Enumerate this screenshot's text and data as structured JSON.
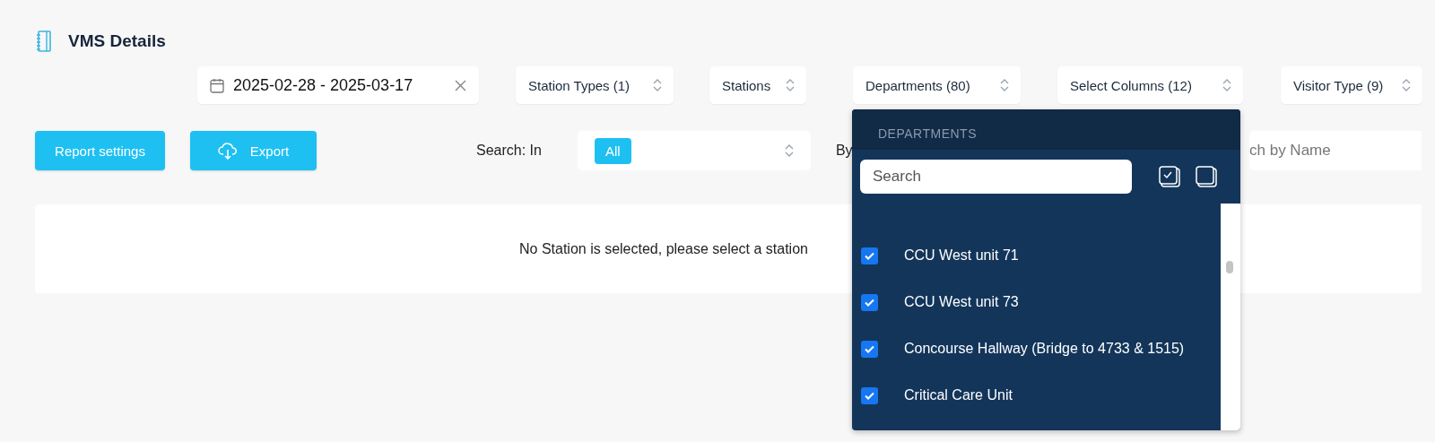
{
  "page": {
    "title": "VMS Details"
  },
  "filters": {
    "date_range": "2025-02-28 - 2025-03-17",
    "dropdowns": [
      {
        "label": "Station Types (1)"
      },
      {
        "label": "Stations"
      },
      {
        "label": "Departments (80)"
      },
      {
        "label": "Select Columns (12)"
      },
      {
        "label": "Visitor Type (9)"
      }
    ]
  },
  "actions": [
    {
      "label": "Report settings",
      "kind": "plain"
    },
    {
      "label": "Export",
      "kind": "export"
    }
  ],
  "search": {
    "in_label": "Search: In",
    "in_chip": "All",
    "by_label": "By",
    "name_placeholder": "ch by Name"
  },
  "message": "No Station is selected, please select a station",
  "departments_menu": {
    "heading": "DEPARTMENTS",
    "search_placeholder": "Search",
    "items": [
      {
        "label": "CCU West unit 71",
        "checked": true
      },
      {
        "label": "CCU West unit 73",
        "checked": true
      },
      {
        "label": "Concourse Hallway (Bridge to 4733 & 1515)",
        "checked": true
      },
      {
        "label": "Critical Care Unit",
        "checked": true
      }
    ]
  }
}
